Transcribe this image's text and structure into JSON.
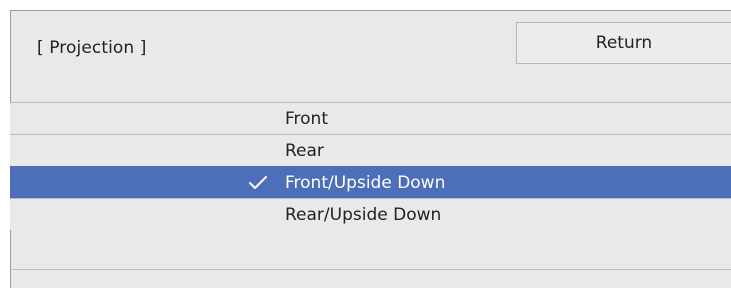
{
  "header": {
    "title": "[ Projection ]",
    "return_label": "Return"
  },
  "options": [
    {
      "label": "Front",
      "selected": false
    },
    {
      "label": "Rear",
      "selected": false
    },
    {
      "label": "Front/Upside Down",
      "selected": true
    },
    {
      "label": "Rear/Upside Down",
      "selected": false
    }
  ],
  "colors": {
    "panel_bg": "#e9e9e9",
    "selected_bg": "#4d6eb8",
    "selected_text": "#ffffff",
    "divider": "#bdbdbd"
  },
  "icons": {
    "selected_marker": "check-icon"
  }
}
